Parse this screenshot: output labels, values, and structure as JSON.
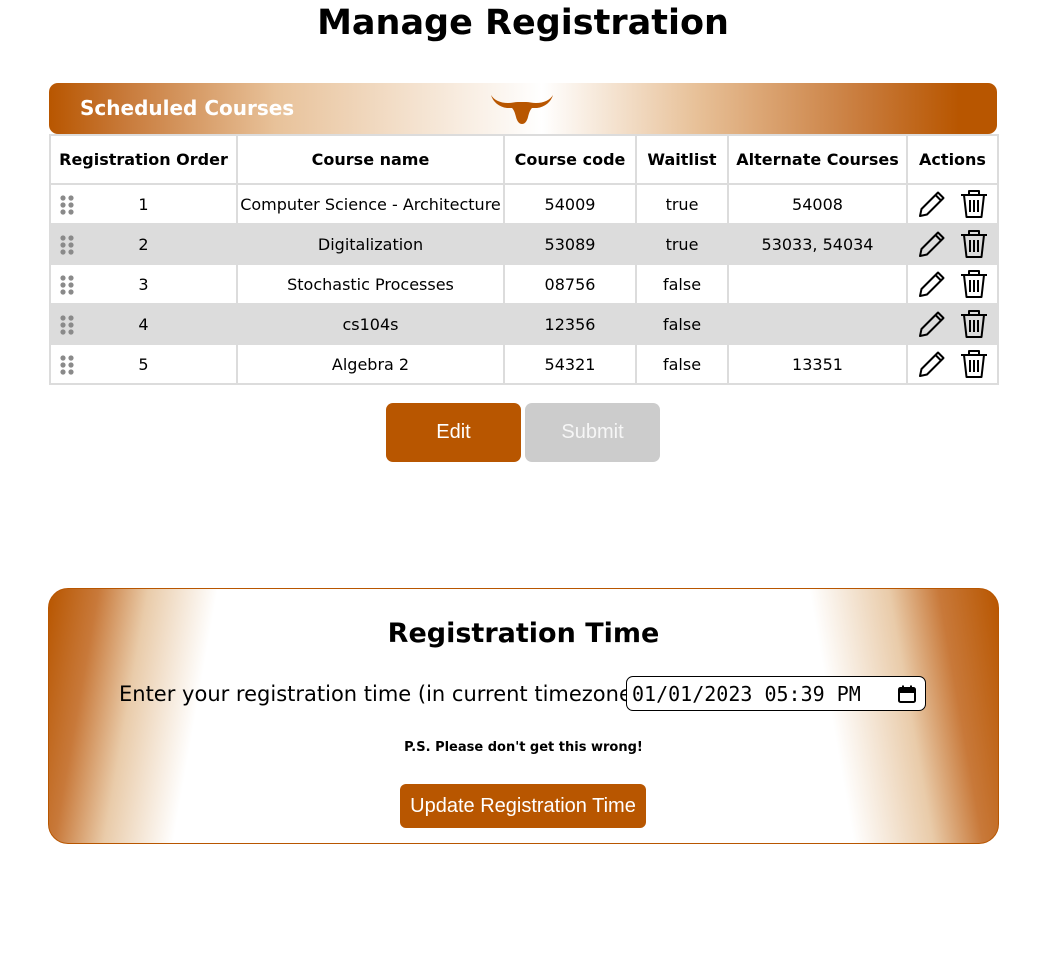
{
  "page": {
    "title": "Manage Registration"
  },
  "scheduled": {
    "header_title": "Scheduled Courses",
    "logo_icon": "longhorn-logo",
    "columns": [
      "Registration Order",
      "Course name",
      "Course code",
      "Waitlist",
      "Alternate Courses",
      "Actions"
    ],
    "rows": [
      {
        "order": "1",
        "course_name": "Computer Science - Architecture",
        "course_code": "54009",
        "waitlist": "true",
        "alternates": "54008"
      },
      {
        "order": "2",
        "course_name": "Digitalization",
        "course_code": "53089",
        "waitlist": "true",
        "alternates": "53033, 54034"
      },
      {
        "order": "3",
        "course_name": "Stochastic Processes",
        "course_code": "08756",
        "waitlist": "false",
        "alternates": ""
      },
      {
        "order": "4",
        "course_name": "cs104s",
        "course_code": "12356",
        "waitlist": "false",
        "alternates": ""
      },
      {
        "order": "5",
        "course_name": "Algebra 2",
        "course_code": "54321",
        "waitlist": "false",
        "alternates": "13351"
      }
    ],
    "row_icons": {
      "drag": "drag-handle-icon",
      "edit": "pencil-icon",
      "delete": "trash-icon"
    }
  },
  "buttons": {
    "edit_label": "Edit",
    "submit_label": "Submit"
  },
  "registration": {
    "title": "Registration Time",
    "label": "Enter your registration time (in current timezone):",
    "datetime_value": "01/01/2023 05:39 PM",
    "note": "P.S. Please don't get this wrong!",
    "update_label": "Update Registration Time"
  },
  "colors": {
    "accent": "#b85600",
    "alt_row": "#dcdcdc",
    "disabled": "#cccccc"
  }
}
